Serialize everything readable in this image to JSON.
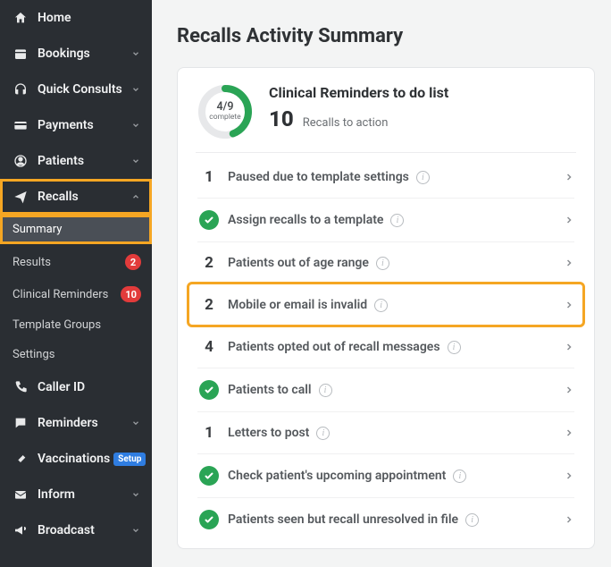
{
  "sidebar": {
    "items": [
      {
        "label": "Home",
        "icon": "home"
      },
      {
        "label": "Bookings",
        "icon": "calendar",
        "chev": "down"
      },
      {
        "label": "Quick Consults",
        "icon": "headset",
        "chev": "down"
      },
      {
        "label": "Payments",
        "icon": "card",
        "chev": "down"
      },
      {
        "label": "Patients",
        "icon": "user",
        "chev": "down"
      },
      {
        "label": "Recalls",
        "icon": "send",
        "chev": "up",
        "expanded": true,
        "highlight": true
      },
      {
        "label": "Caller ID",
        "icon": "phone"
      },
      {
        "label": "Reminders",
        "icon": "chat",
        "chev": "down"
      },
      {
        "label": "Vaccinations",
        "icon": "syringe",
        "setup": "Setup"
      },
      {
        "label": "Inform",
        "icon": "mail",
        "chev": "down"
      },
      {
        "label": "Broadcast",
        "icon": "megaphone",
        "chev": "down"
      }
    ],
    "recalls_sub": [
      {
        "label": "Summary",
        "active": true,
        "highlight": true
      },
      {
        "label": "Results",
        "badge": "2"
      },
      {
        "label": "Clinical Reminders",
        "badge": "10"
      },
      {
        "label": "Template Groups"
      },
      {
        "label": "Settings"
      }
    ]
  },
  "page": {
    "title": "Recalls Activity Summary",
    "card_title": "Clinical Reminders to do list",
    "big_count": "10",
    "big_sub": "Recalls to action",
    "ring_done": 4,
    "ring_total": 9,
    "ring_fraction": "4/9",
    "ring_label": "complete",
    "rows": [
      {
        "count": "1",
        "label": "Paused due to template settings"
      },
      {
        "done": true,
        "label": "Assign recalls to a template"
      },
      {
        "count": "2",
        "label": "Patients out of age range"
      },
      {
        "count": "2",
        "label": "Mobile or email is invalid",
        "highlight": true
      },
      {
        "count": "4",
        "label": "Patients opted out of recall messages"
      },
      {
        "done": true,
        "label": "Patients to call"
      },
      {
        "count": "1",
        "label": "Letters to post"
      },
      {
        "done": true,
        "label": "Check patient's upcoming appointment"
      },
      {
        "done": true,
        "label": "Patients seen but recall unresolved in file"
      }
    ]
  }
}
